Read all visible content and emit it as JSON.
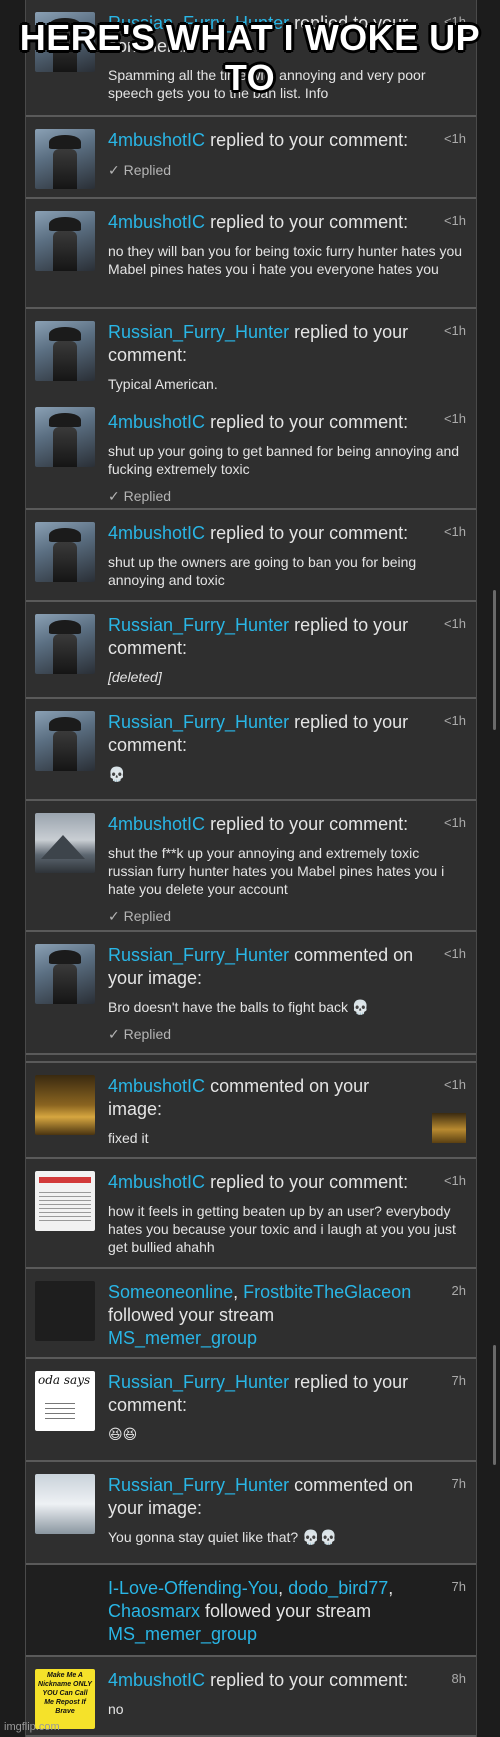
{
  "caption": "HERE'S WHAT I WOKE UP TO",
  "watermark": "imgflip.com",
  "notifications": [
    {
      "user": "Russian_Furry_Hunter",
      "action": "replied to your comment:",
      "time": "<1h",
      "body": "Spamming all the time with annoying and very poor speech gets you to the ban list. Info",
      "replied": ""
    },
    {
      "user": "4mbushotIC",
      "action": "replied to your comment:",
      "time": "<1h",
      "body": "",
      "replied": "✓ Replied"
    },
    {
      "user": "4mbushotIC",
      "action": "replied to your comment:",
      "time": "<1h",
      "body": "no they will ban you for being toxic furry hunter hates you Mabel pines hates you i hate you everyone hates you",
      "replied": ""
    },
    {
      "user": "Russian_Furry_Hunter",
      "action": "replied to your comment:",
      "time": "<1h",
      "body": "Typical American.",
      "replied": ""
    },
    {
      "user": "4mbushotIC",
      "action": "replied to your comment:",
      "time": "<1h",
      "body": "shut up your going to get banned for being annoying and fucking extremely toxic",
      "replied": "✓ Replied"
    },
    {
      "user": "4mbushotIC",
      "action": "replied to your comment:",
      "time": "<1h",
      "body": "shut up the owners are going to ban you for being annoying and toxic",
      "replied": ""
    },
    {
      "user": "Russian_Furry_Hunter",
      "action": "replied to your comment:",
      "time": "<1h",
      "body": "[deleted]",
      "replied": ""
    },
    {
      "user": "Russian_Furry_Hunter",
      "action": "replied to your comment:",
      "time": "<1h",
      "body": "💀",
      "replied": ""
    },
    {
      "user": "4mbushotIC",
      "action": "replied to your comment:",
      "time": "<1h",
      "body": "shut the f**k up your annoying and extremely toxic russian furry hunter hates you Mabel pines hates you i hate you delete your account",
      "replied": "✓ Replied"
    },
    {
      "user": "Russian_Furry_Hunter",
      "action": "commented on your image:",
      "time": "<1h",
      "body": "Bro doesn't have the balls to fight back 💀",
      "replied": "✓ Replied"
    },
    {
      "user": "4mbushotIC",
      "action": "commented on your image:",
      "time": "<1h",
      "body": "fixed it",
      "replied": ""
    },
    {
      "user": "4mbushotIC",
      "action": "replied to your comment:",
      "time": "<1h",
      "body": "how it feels in getting beaten up by an user? everybody hates you because your toxic and i laugh at you you just get bullied ahahh",
      "replied": ""
    },
    {
      "users": [
        "Someoneonline",
        "FrostbiteTheGlaceon"
      ],
      "action": "followed your stream",
      "stream": "MS_memer_group",
      "time": "2h"
    },
    {
      "user": "Russian_Furry_Hunter",
      "action": "replied to your comment:",
      "time": "7h",
      "body": "😆😆",
      "replied": "",
      "avatar_text": "oda says"
    },
    {
      "user": "Russian_Furry_Hunter",
      "action": "commented on your image:",
      "time": "7h",
      "body": "You gonna stay quiet like that? 💀💀",
      "replied": ""
    },
    {
      "users": [
        "I-Love-Offending-You",
        "dodo_bird77",
        "Chaosmarx"
      ],
      "action": "followed your stream",
      "stream": "MS_memer_group",
      "time": "7h"
    },
    {
      "user": "4mbushotIC",
      "action": "replied to your comment:",
      "time": "8h",
      "body": "no",
      "replied": "",
      "avatar_text": "Make Me A Nickname ONLY YOU Can Call Me Repost If Brave"
    }
  ],
  "icons": {
    "avatar_default": "ninja-avatar-icon",
    "image_thumb": "temple-thumbnail-icon"
  }
}
